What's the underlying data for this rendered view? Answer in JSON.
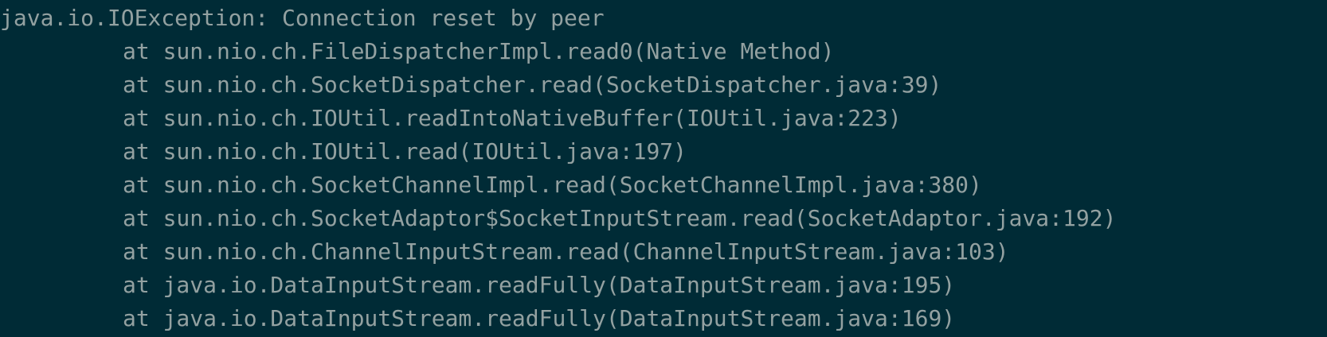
{
  "terminal": {
    "colors": {
      "background": "#002b36",
      "text": "#93a1a1"
    },
    "exception": "java.io.IOException: Connection reset by peer",
    "stack_frames": [
      "at sun.nio.ch.FileDispatcherImpl.read0(Native Method)",
      "at sun.nio.ch.SocketDispatcher.read(SocketDispatcher.java:39)",
      "at sun.nio.ch.IOUtil.readIntoNativeBuffer(IOUtil.java:223)",
      "at sun.nio.ch.IOUtil.read(IOUtil.java:197)",
      "at sun.nio.ch.SocketChannelImpl.read(SocketChannelImpl.java:380)",
      "at sun.nio.ch.SocketAdaptor$SocketInputStream.read(SocketAdaptor.java:192)",
      "at sun.nio.ch.ChannelInputStream.read(ChannelInputStream.java:103)",
      "at java.io.DataInputStream.readFully(DataInputStream.java:195)",
      "at java.io.DataInputStream.readFully(DataInputStream.java:169)"
    ]
  }
}
